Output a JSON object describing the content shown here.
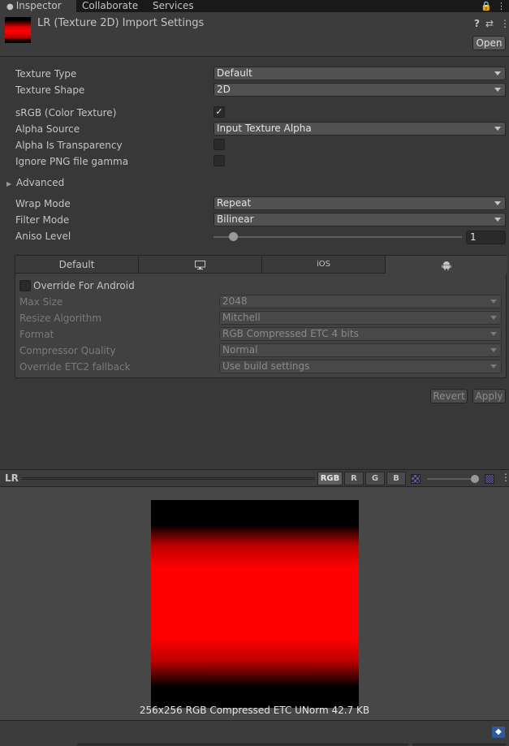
{
  "tabs": [
    {
      "label": "Inspector",
      "active": true
    },
    {
      "label": "Collaborate",
      "active": false
    },
    {
      "label": "Services",
      "active": false
    }
  ],
  "header": {
    "title": "LR (Texture 2D) Import Settings",
    "open_label": "Open",
    "icons": [
      "help-icon",
      "preset-icon",
      "more-icon"
    ]
  },
  "settings": {
    "texture_type": {
      "label": "Texture Type",
      "value": "Default"
    },
    "texture_shape": {
      "label": "Texture Shape",
      "value": "2D"
    },
    "srgb": {
      "label": "sRGB (Color Texture)",
      "checked": true,
      "mark": "✓"
    },
    "alpha_source": {
      "label": "Alpha Source",
      "value": "Input Texture Alpha"
    },
    "alpha_transparency": {
      "label": "Alpha Is Transparency",
      "checked": false
    },
    "ignore_png_gamma": {
      "label": "Ignore PNG file gamma",
      "checked": false
    },
    "advanced": {
      "label": "Advanced"
    },
    "wrap_mode": {
      "label": "Wrap Mode",
      "value": "Repeat"
    },
    "filter_mode": {
      "label": "Filter Mode",
      "value": "Bilinear"
    },
    "aniso_level": {
      "label": "Aniso Level",
      "value": "1"
    }
  },
  "platform": {
    "tabs": [
      {
        "label": "Default",
        "icon": ""
      },
      {
        "label": "",
        "icon": "monitor-icon"
      },
      {
        "label": "iOS",
        "icon": ""
      },
      {
        "label": "",
        "icon": "android-icon"
      }
    ],
    "override_label": "Override For Android",
    "rows": [
      {
        "label": "Max Size",
        "value": "2048"
      },
      {
        "label": "Resize Algorithm",
        "value": "Mitchell"
      },
      {
        "label": "Format",
        "value": "RGB Compressed ETC 4 bits"
      },
      {
        "label": "Compressor Quality",
        "value": "Normal"
      },
      {
        "label": "Override ETC2 fallback",
        "value": "Use build settings"
      }
    ]
  },
  "actions": {
    "revert": "Revert",
    "apply": "Apply"
  },
  "preview": {
    "name": "LR",
    "channels": [
      "RGB",
      "R",
      "G",
      "B"
    ],
    "info": "256x256  RGB Compressed ETC UNorm   42.7 KB"
  },
  "colors": {
    "background": "#383838",
    "texture_red": "#ff0000"
  }
}
